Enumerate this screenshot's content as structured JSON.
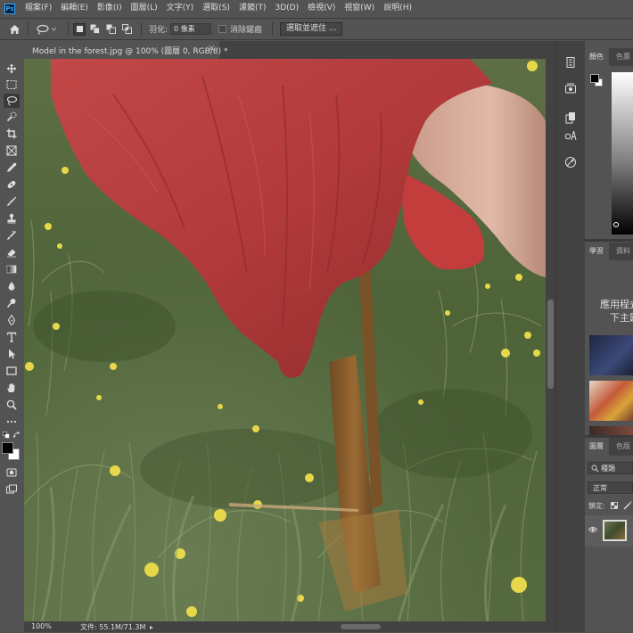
{
  "app": {
    "logo_text": "Ps"
  },
  "menu": [
    "檔案(F)",
    "編輯(E)",
    "影像(I)",
    "圖層(L)",
    "文字(Y)",
    "選取(S)",
    "濾鏡(T)",
    "3D(D)",
    "檢視(V)",
    "視窗(W)",
    "說明(H)"
  ],
  "options": {
    "feather_label": "羽化:",
    "feather_value": "0 像素",
    "antialias_label": "消除鋸齒",
    "select_mask_button": "選取並遮住 ..."
  },
  "document": {
    "tab_title": "Model in the forest.jpg @ 100% (圖層 0, RGB/8) *",
    "close_glyph": "×"
  },
  "status": {
    "zoom": "100%",
    "doc_size": "文件: 55.1M/71.3M"
  },
  "panels": {
    "color_tabs": [
      "顏色",
      "色票"
    ],
    "learn_tabs": [
      "學習",
      "資料"
    ],
    "learn_text_1": "應用程式",
    "learn_text_2": "下主題",
    "layers_tabs": [
      "圖層",
      "色版"
    ],
    "layers_search": "種類",
    "blend_mode": "正常",
    "lock_label": "鎖定:"
  },
  "colors": {
    "foreground": "#000000",
    "background": "#ffffff",
    "ui_bg": "#535353",
    "ui_dark": "#424242",
    "dress": "#b23a3a"
  },
  "tools": [
    "move-tool",
    "marquee-tool",
    "lasso-tool",
    "quick-select-tool",
    "crop-tool",
    "frame-tool",
    "eyedropper-tool",
    "healing-tool",
    "brush-tool",
    "clone-stamp-tool",
    "history-brush-tool",
    "eraser-tool",
    "gradient-tool",
    "blur-tool",
    "dodge-tool",
    "pen-tool",
    "type-tool",
    "path-select-tool",
    "rectangle-tool",
    "hand-tool",
    "zoom-tool",
    "more-tools"
  ]
}
